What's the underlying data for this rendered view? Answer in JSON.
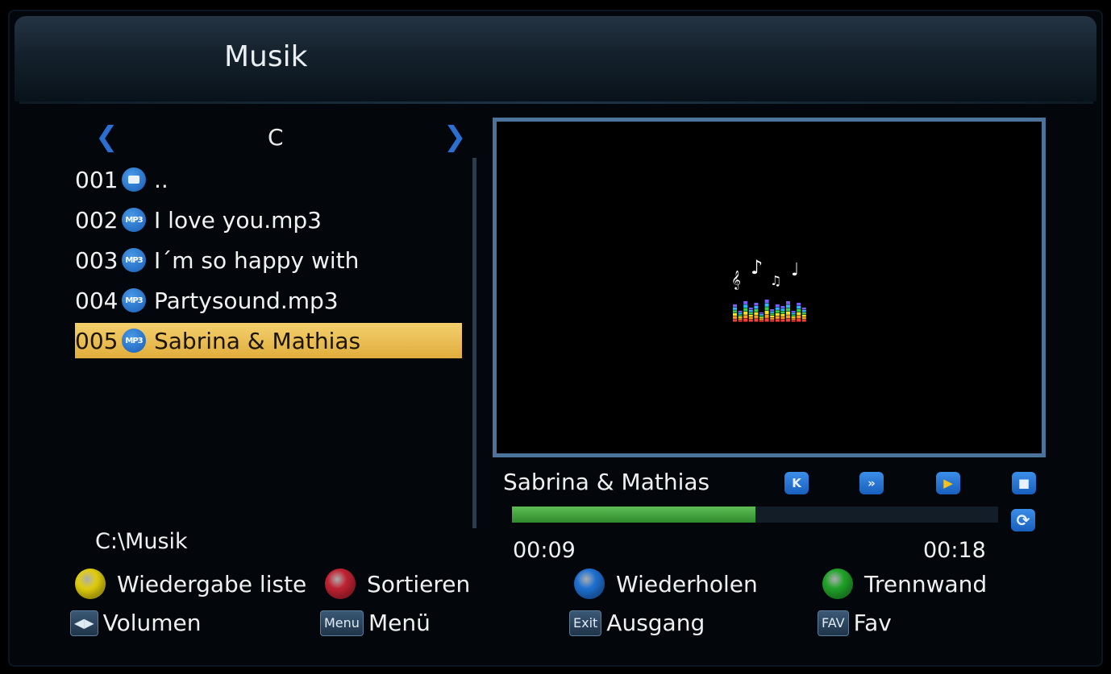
{
  "header": {
    "title": "Musik"
  },
  "browser": {
    "drive": "C",
    "prev_icon": "chevron-left-icon",
    "next_icon": "chevron-right-icon",
    "files": [
      {
        "number": "001",
        "type": "folder",
        "icon_label": "",
        "name": ".."
      },
      {
        "number": "002",
        "type": "mp3",
        "icon_label": "MP3",
        "name": "I love you.mp3"
      },
      {
        "number": "003",
        "type": "mp3",
        "icon_label": "MP3",
        "name": "I´m so happy with"
      },
      {
        "number": "004",
        "type": "mp3",
        "icon_label": "MP3",
        "name": "Partysound.mp3"
      },
      {
        "number": "005",
        "type": "mp3",
        "icon_label": "MP3",
        "name": "Sabrina & Mathias",
        "selected": true
      }
    ],
    "path": "C:\\Musik"
  },
  "player": {
    "track_title": "Sabrina & Mathias",
    "controls": {
      "prev_symbol": "K",
      "next_symbol": "»",
      "play_symbol": "▶",
      "stop_symbol": "■",
      "repeat_symbol": "⟳"
    },
    "elapsed": "00:09",
    "total": "00:18",
    "progress_fraction": 0.5
  },
  "legend": {
    "yellow": {
      "label": "Wiedergabe liste",
      "color": "#e6d20f"
    },
    "red": {
      "label": "Sortieren",
      "color": "#c42333"
    },
    "blue": {
      "label": "Wiederholen",
      "color": "#1f73d6"
    },
    "green": {
      "label": "Trennwand",
      "color": "#21a62a"
    },
    "volume": {
      "key": "◀▶",
      "label": "Volumen"
    },
    "menu": {
      "key": "Menu",
      "label": "Menü"
    },
    "exit": {
      "key": "Exit",
      "label": "Ausgang"
    },
    "fav": {
      "key": "FAV",
      "label": "Fav"
    }
  }
}
